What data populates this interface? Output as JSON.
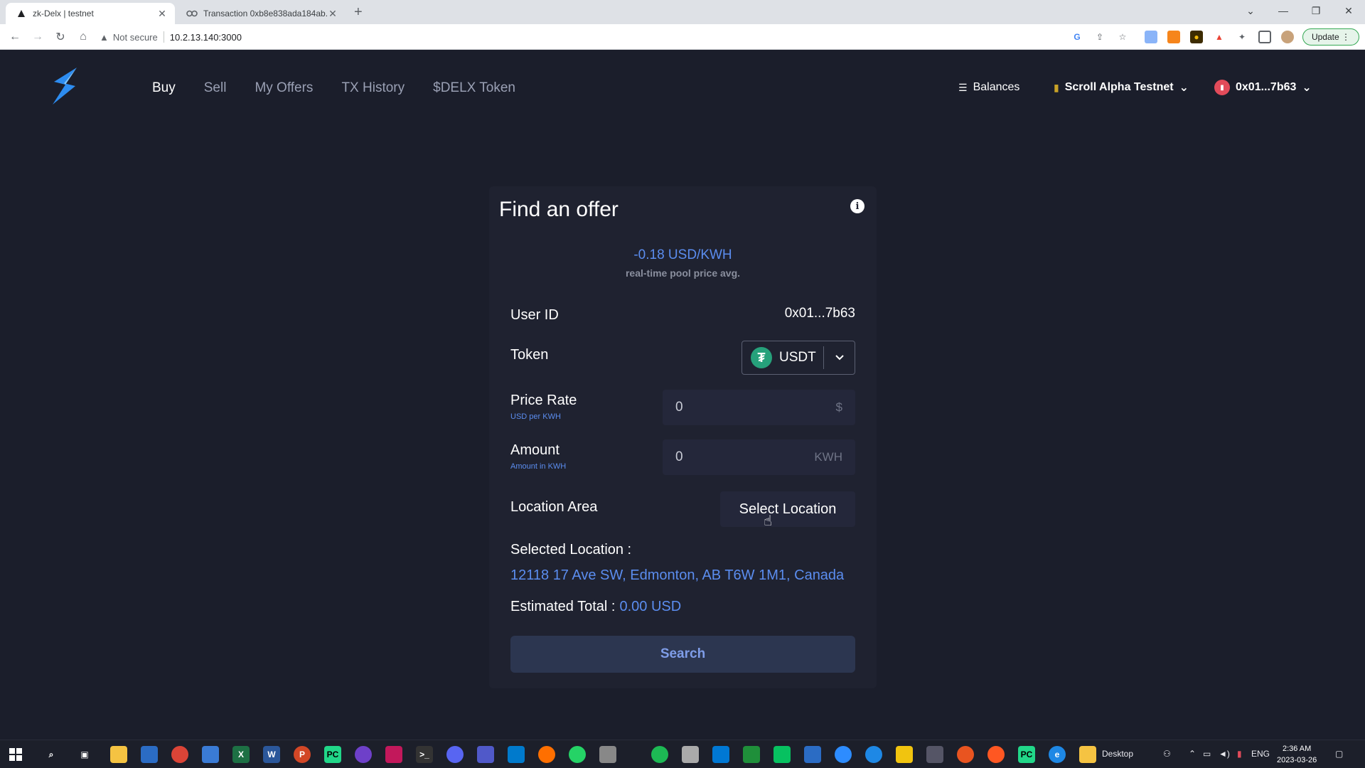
{
  "browser": {
    "tabs": [
      {
        "title": "zk-Delx | testnet",
        "active": true
      },
      {
        "title": "Transaction 0xb8e838ada184ab...",
        "active": false
      }
    ],
    "address": {
      "security": "Not secure",
      "url": "10.2.13.140:3000"
    },
    "update_label": "Update"
  },
  "header": {
    "nav": [
      "Buy",
      "Sell",
      "My Offers",
      "TX History",
      "$DELX Token"
    ],
    "active_nav": "Buy",
    "balances_label": "Balances",
    "network_label": "Scroll Alpha Testnet",
    "account_label": "0x01...7b63"
  },
  "card": {
    "title": "Find an offer",
    "price": {
      "value": "-0.18 USD/KWH",
      "caption": "real-time pool price avg."
    },
    "user_id": {
      "label": "User ID",
      "value": "0x01...7b63"
    },
    "token": {
      "label": "Token",
      "selected": "USDT"
    },
    "price_rate": {
      "label": "Price Rate",
      "sub": "USD per KWH",
      "value": "0",
      "unit": "$"
    },
    "amount": {
      "label": "Amount",
      "sub": "Amount in KWH",
      "value": "0",
      "unit": "KWH"
    },
    "location": {
      "label": "Location Area",
      "button": "Select Location"
    },
    "selected_location": {
      "label": "Selected Location :",
      "address": "12118 17 Ave SW, Edmonton, AB T6W 1M1, Canada"
    },
    "estimated_total": {
      "label": "Estimated Total :",
      "value": "0.00 USD"
    },
    "search_label": "Search"
  },
  "taskbar": {
    "desktop_label": "Desktop",
    "lang": "ENG",
    "time": "2:36 AM",
    "date": "2023-03-26"
  },
  "colors": {
    "accent": "#5b8def",
    "background": "#1b1e2b",
    "card": "#1f2230",
    "tether": "#26a17b"
  }
}
